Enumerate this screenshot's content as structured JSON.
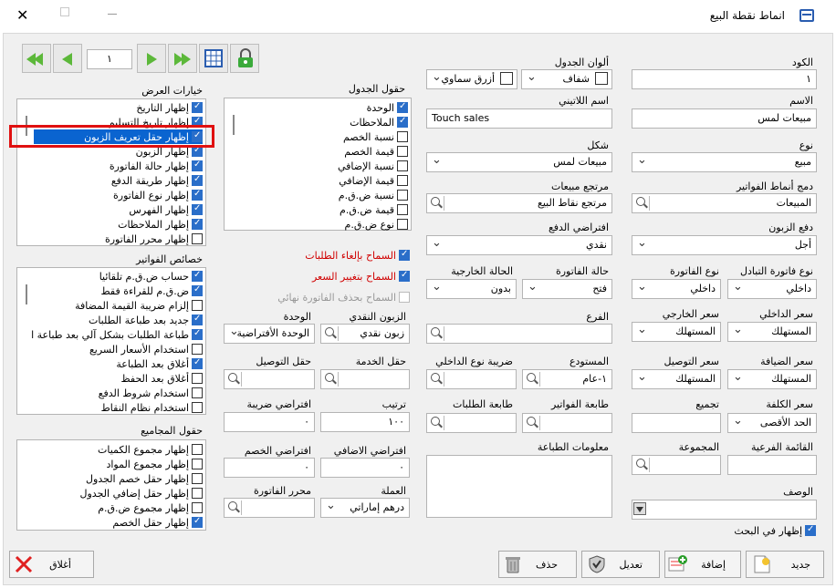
{
  "window": {
    "title": "انماط نقطة البيع"
  },
  "toolbar": {
    "page_number": "١"
  },
  "fields": {
    "code_label": "الكود",
    "code_value": "١",
    "name_label": "الاسم",
    "name_value": "مبيعات لمس",
    "type_label": "نوع",
    "type_value": "مبيع",
    "merge_label": "دمج أنماط الفواتير",
    "merge_value": "المبيعات",
    "payment_label": "دفع الزبون",
    "payment_value": "أجل",
    "invoice_type_label": "نوع فاتورة التبادل",
    "invoice_type_value": "داخلي",
    "internal_price_label": "سعر الداخلي",
    "internal_price_value": "المستهلك",
    "hospitality_price_label": "سعر الضيافة",
    "hospitality_price_value": "المستهلك",
    "cost_price_label": "سعر الكلفة",
    "cost_price_value": "الحد الأقصى",
    "sub_list_label": "القائمة الفرعية",
    "description_label": "الوصف",
    "show_in_search_label": "إظهار في البحث",
    "table_colors_label": "ألوان الجدول",
    "color1_value": "شفاف",
    "color2_value": "أزرق سماوي",
    "latin_name_label": "اسم اللاتيني",
    "latin_name_value": "Touch sales",
    "shape_label": "شكل",
    "shape_value": "مبيعات لمس",
    "sales_return_label": "مرتجع مبيعات",
    "sales_return_value": "مرتجع نقاط البيع",
    "default_payment_label": "افتراضي الدفع",
    "default_payment_value": "نقدي",
    "invoice_status_label": "حالة الفاتورة",
    "invoice_status_value": "فتح",
    "external_status_label": "الحالة الخارجية",
    "external_status_value": "بدون",
    "invoice_type2_label": "نوع الفاتورة",
    "invoice_type2_value": "داخلي",
    "external_price_label": "سعر الخارجي",
    "external_price_value": "المستهلك",
    "delivery_price_label": "سعر التوصيل",
    "delivery_price_value": "المستهلك",
    "branch_label": "الفرع",
    "warehouse_label": "المستودع",
    "warehouse_value": "١-عام",
    "internal_tax_label": "ضريبة نوع الداخلي",
    "invoice_printer_label": "طابعة الفواتير",
    "order_printer_label": "طابعة الطلبات",
    "collect_label": "تجميع",
    "group_label": "المجموعة",
    "print_info_label": "معلومات الطباعة",
    "cash_customer_label": "الزبون النقدي",
    "cash_customer_value": "زبون نقدي",
    "unit_label": "الوحدة",
    "unit_value": "الوحدة الأفتراضية",
    "service_field_label": "حقل الخدمة",
    "delivery_field_label": "حقل التوصيل",
    "order_label": "ترتيب",
    "order_value": "١٠٠",
    "default_tax_label": "افتراضي ضريبة",
    "default_tax_value": "٠",
    "default_extra_label": "افتراضي الاضافي",
    "default_extra_value": "٠",
    "default_discount_label": "افتراضي الخصم",
    "default_discount_value": "٠",
    "currency_label": "العملة",
    "currency_value": "درهم إماراتي",
    "invoice_editor_label": "محرر الفاتورة"
  },
  "permissions": {
    "cancel_orders": "السماح بإلغاء الطلبات",
    "change_price": "السماح بتغيير السعر",
    "delete_invoice": "السماح بحذف الفاتورة نهائي"
  },
  "table_fields": {
    "title": "حقول الجدول",
    "items": [
      {
        "label": "الوحدة",
        "checked": true
      },
      {
        "label": "الملاحظات",
        "checked": true
      },
      {
        "label": "نسبة الخصم",
        "checked": false
      },
      {
        "label": "قيمة الخصم",
        "checked": false
      },
      {
        "label": "نسبة الإضافي",
        "checked": false
      },
      {
        "label": "قيمة الإضافي",
        "checked": false
      },
      {
        "label": "نسبة ض.ق.م",
        "checked": false
      },
      {
        "label": "قيمة ض.ق.م",
        "checked": false
      },
      {
        "label": "نوع ض.ق.م",
        "checked": false
      }
    ]
  },
  "display_options": {
    "title": "خيارات العرض",
    "items": [
      {
        "label": "إظهار التاريخ",
        "checked": true
      },
      {
        "label": "إظهار تاريخ التسليم",
        "checked": true
      },
      {
        "label": "إظهار حقل تعريف الزبون",
        "checked": true
      },
      {
        "label": "إظهار الزبون",
        "checked": true
      },
      {
        "label": "إظهار حالة الفاتورة",
        "checked": true
      },
      {
        "label": "إظهار طريقة الدفع",
        "checked": true
      },
      {
        "label": "إظهار نوع الفاتورة",
        "checked": true
      },
      {
        "label": "إظهار الفهرس",
        "checked": true
      },
      {
        "label": "إظهار الملاحظات",
        "checked": true
      },
      {
        "label": "إظهار محرر الفاتورة",
        "checked": false
      }
    ]
  },
  "invoice_props": {
    "title": "خصائص الفواتير",
    "items": [
      {
        "label": "حساب ض.ق.م تلقائيا",
        "checked": true
      },
      {
        "label": "ض.ق.م للقراءة فقط",
        "checked": true
      },
      {
        "label": "إلزام ضريبة القيمة المضافة",
        "checked": false
      },
      {
        "label": "جديد بعد طباعة الطلبات",
        "checked": true
      },
      {
        "label": "طباعة الطلبات بشكل آلي بعد طباعة ا",
        "checked": true
      },
      {
        "label": "استخدام الأسعار السريع",
        "checked": false
      },
      {
        "label": "أغلاق بعد الطباعة",
        "checked": true
      },
      {
        "label": "أغلاق بعد الحفظ",
        "checked": false
      },
      {
        "label": "استخدام شروط الدفع",
        "checked": false
      },
      {
        "label": "استخدام نظام النقاط",
        "checked": false
      }
    ]
  },
  "totals_fields": {
    "title": "حقول المجاميع",
    "items": [
      {
        "label": "إظهار مجموع الكميات",
        "checked": false
      },
      {
        "label": "إظهار مجموع المواد",
        "checked": false
      },
      {
        "label": "إظهار حقل خصم الجدول",
        "checked": false
      },
      {
        "label": "إظهار حقل إضافي الجدول",
        "checked": false
      },
      {
        "label": "إظهار مجموع ض.ق.م",
        "checked": false
      },
      {
        "label": "إظهار حقل الخصم",
        "checked": true
      }
    ]
  },
  "buttons": {
    "new": "جديد",
    "add": "إضافة",
    "edit": "تعديل",
    "delete": "حذف",
    "close": "أغلاق"
  }
}
